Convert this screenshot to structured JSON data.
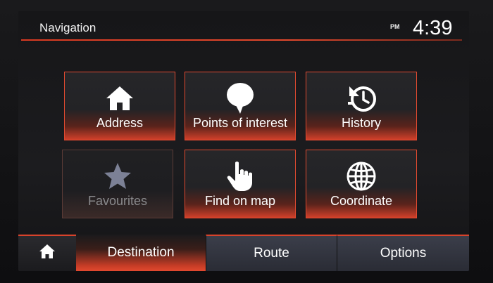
{
  "header": {
    "title": "Navigation",
    "ampm": "PM",
    "time": "4:39"
  },
  "colors": {
    "accent": "#e04a30",
    "background": "#1c1c1f",
    "text": "#ffffff",
    "disabled_text": "#8a8a8d"
  },
  "tiles": [
    {
      "label": "Address",
      "icon": "home-icon",
      "enabled": true
    },
    {
      "label": "Points of interest",
      "icon": "map-pin-icon",
      "enabled": true
    },
    {
      "label": "History",
      "icon": "history-clock-icon",
      "enabled": true
    },
    {
      "label": "Favourites",
      "icon": "star-icon",
      "enabled": false
    },
    {
      "label": "Find on map",
      "icon": "pointing-hand-icon",
      "enabled": true
    },
    {
      "label": "Coordinate",
      "icon": "globe-icon",
      "enabled": true
    }
  ],
  "tabs": {
    "home_icon": "home-icon",
    "destination": "Destination",
    "route": "Route",
    "options": "Options",
    "active": "destination"
  }
}
